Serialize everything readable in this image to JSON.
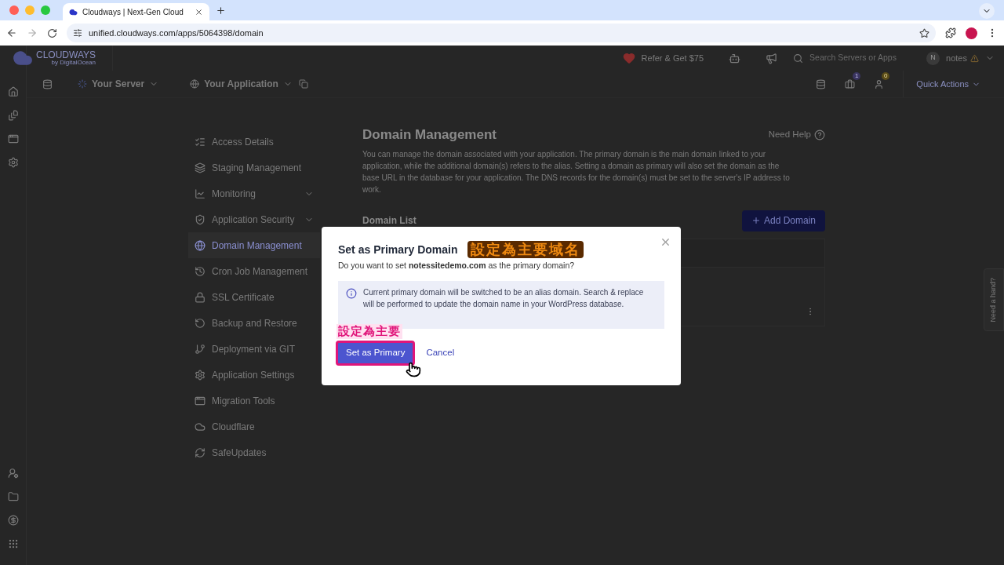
{
  "browser": {
    "tab_title": "Cloudways | Next-Gen Cloud",
    "url": "unified.cloudways.com/apps/5064398/domain"
  },
  "header": {
    "logo": "CLOUDWAYS",
    "logo_sub": "by DigitalOcean",
    "refer": "Refer & Get $75",
    "search_placeholder": "Search Servers or Apps",
    "user_initial": "N",
    "user_name": "notes"
  },
  "toolbar": {
    "server": "Your Server",
    "application": "Your Application",
    "badges": [
      "1",
      "0"
    ],
    "quick_actions": "Quick Actions"
  },
  "nav": [
    {
      "label": "Access Details",
      "expandable": false,
      "selected": false
    },
    {
      "label": "Staging Management",
      "expandable": false,
      "selected": false
    },
    {
      "label": "Monitoring",
      "expandable": true,
      "selected": false
    },
    {
      "label": "Application Security",
      "expandable": true,
      "selected": false
    },
    {
      "label": "Domain Management",
      "expandable": false,
      "selected": true
    },
    {
      "label": "Cron Job Management",
      "expandable": false,
      "selected": false
    },
    {
      "label": "SSL Certificate",
      "expandable": false,
      "selected": false
    },
    {
      "label": "Backup and Restore",
      "expandable": false,
      "selected": false
    },
    {
      "label": "Deployment via GIT",
      "expandable": false,
      "selected": false
    },
    {
      "label": "Application Settings",
      "expandable": false,
      "selected": false
    },
    {
      "label": "Migration Tools",
      "expandable": false,
      "selected": false
    },
    {
      "label": "Cloudflare",
      "expandable": false,
      "selected": false
    },
    {
      "label": "SafeUpdates",
      "expandable": false,
      "selected": false
    }
  ],
  "page": {
    "title": "Domain Management",
    "need_help": "Need Help",
    "description": "You can manage the domain associated with your application. The primary domain is the main domain linked to your application, while the additional domain(s) refers to the alias. Setting a domain as primary will also set the domain as the base URL in the database for your application. The DNS records for the domain(s) must be set to the server's IP address to work.",
    "domain_list": "Domain List",
    "add_domain": "Add Domain"
  },
  "dialog": {
    "title": "Set as Primary Domain",
    "title_callout": "設定為主要域名",
    "question": "Do you want to set **notessitedemo.com** as the primary domain?",
    "info": "Current primary domain will be switched to be an alias domain. Search & replace will be performed to update the domain name in your WordPress database.",
    "button_callout": "設定為主要",
    "confirm": "Set as Primary",
    "cancel": "Cancel"
  },
  "help_tab": "Need a hand?"
}
